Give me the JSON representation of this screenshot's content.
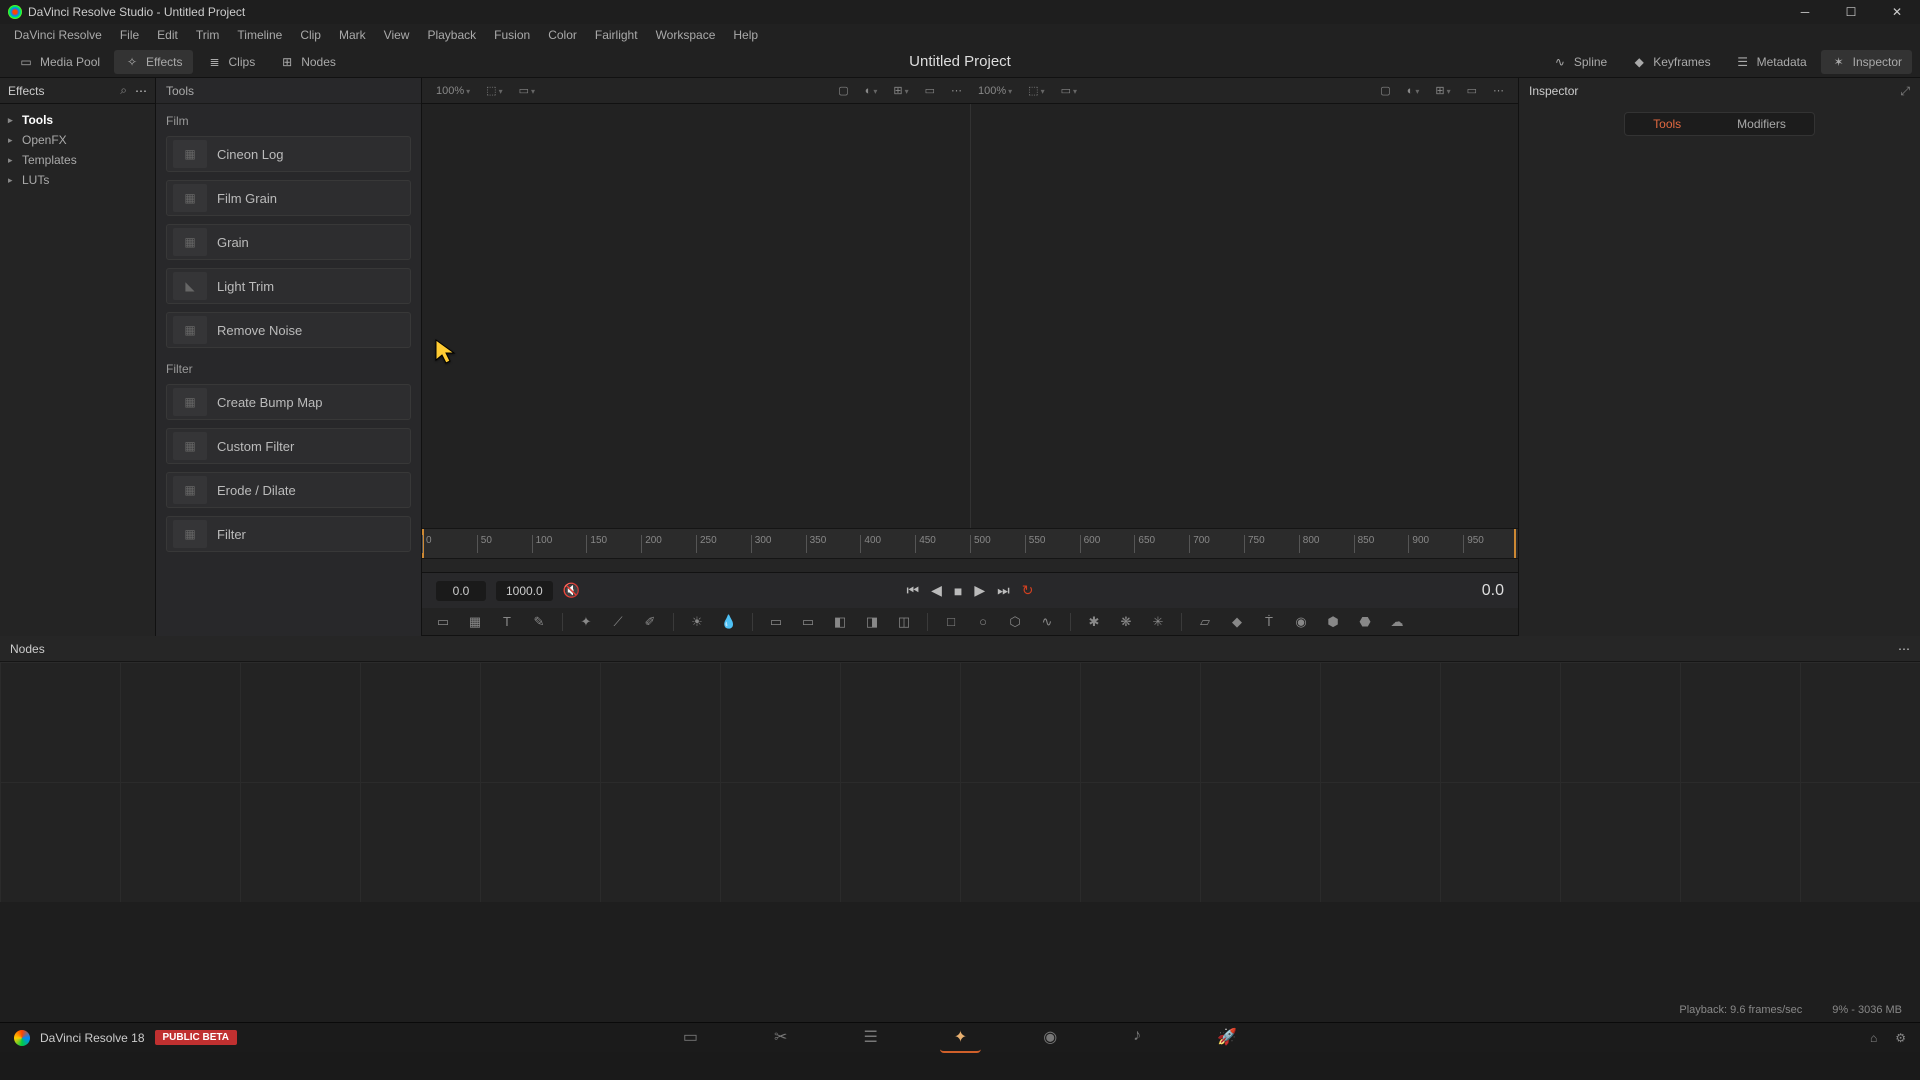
{
  "titlebar": {
    "title": "DaVinci Resolve Studio - Untitled Project"
  },
  "menu": [
    "DaVinci Resolve",
    "File",
    "Edit",
    "Trim",
    "Timeline",
    "Clip",
    "Mark",
    "View",
    "Playback",
    "Fusion",
    "Color",
    "Fairlight",
    "Workspace",
    "Help"
  ],
  "toolbar": {
    "left": [
      {
        "name": "media-pool-button",
        "label": "Media Pool"
      },
      {
        "name": "effects-button",
        "label": "Effects"
      },
      {
        "name": "clips-button",
        "label": "Clips"
      },
      {
        "name": "nodes-button",
        "label": "Nodes"
      }
    ],
    "center_title": "Untitled Project",
    "right": [
      {
        "name": "spline-button",
        "label": "Spline"
      },
      {
        "name": "keyframes-button",
        "label": "Keyframes"
      },
      {
        "name": "metadata-button",
        "label": "Metadata"
      },
      {
        "name": "inspector-button",
        "label": "Inspector"
      }
    ]
  },
  "effects": {
    "header": "Effects",
    "tree": [
      {
        "label": "Tools",
        "selected": true
      },
      {
        "label": "OpenFX"
      },
      {
        "label": "Templates"
      },
      {
        "label": "LUTs"
      }
    ]
  },
  "tools": {
    "header": "Tools",
    "groups": [
      {
        "title": "Film",
        "items": [
          "Cineon Log",
          "Film Grain",
          "Grain",
          "Light Trim",
          "Remove Noise"
        ]
      },
      {
        "title": "Filter",
        "items": [
          "Create Bump Map",
          "Custom Filter",
          "Erode / Dilate",
          "Filter"
        ]
      }
    ]
  },
  "viewer": {
    "zoom_left": "100%",
    "zoom_right": "100%",
    "ruler_ticks": [
      "0",
      "50",
      "100",
      "150",
      "200",
      "250",
      "300",
      "350",
      "400",
      "450",
      "500",
      "550",
      "600",
      "650",
      "700",
      "750",
      "800",
      "850",
      "900",
      "950"
    ],
    "transport": {
      "in": "0.0",
      "out": "1000.0",
      "tc": "0.0"
    }
  },
  "inspector": {
    "header": "Inspector",
    "tabs": [
      "Tools",
      "Modifiers"
    ],
    "active_tab": 0
  },
  "nodes": {
    "header": "Nodes"
  },
  "status": {
    "playback": "Playback: 9.6 frames/sec",
    "mem": "9% - 3036 MB"
  },
  "page_nav": {
    "brand": "DaVinci Resolve 18",
    "beta": "PUBLIC BETA"
  }
}
